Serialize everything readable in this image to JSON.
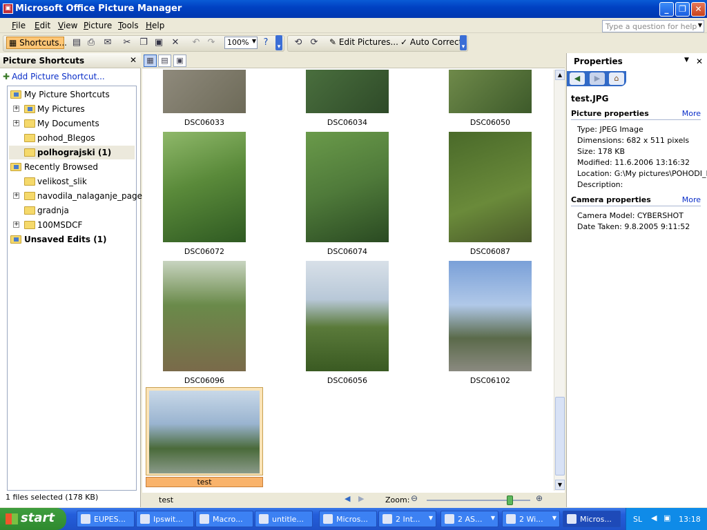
{
  "window": {
    "title": "Microsoft Office Picture Manager"
  },
  "menu": [
    "File",
    "Edit",
    "View",
    "Picture",
    "Tools",
    "Help"
  ],
  "help_box": {
    "placeholder": "Type a question for help"
  },
  "toolbar": {
    "shortcuts_label": "Shortcuts...",
    "zoom_value": "100%",
    "edit_pictures_label": "Edit Pictures...",
    "auto_correct_label": "Auto Correct"
  },
  "left_pane": {
    "title": "Picture Shortcuts",
    "add_shortcut": "Add Picture Shortcut...",
    "tree": [
      {
        "label": "My Picture Shortcuts",
        "bold": false
      },
      {
        "label": "My Pictures",
        "bold": false
      },
      {
        "label": "My Documents",
        "bold": false
      },
      {
        "label": "pohod_Blegos",
        "bold": false
      },
      {
        "label": "polhograjski (1)",
        "bold": true
      },
      {
        "label": "Recently Browsed",
        "bold": false
      },
      {
        "label": "velikost_slik",
        "bold": false
      },
      {
        "label": "navodila_nalaganje_page",
        "bold": false
      },
      {
        "label": "gradnja",
        "bold": false
      },
      {
        "label": "100MSDCF",
        "bold": false
      },
      {
        "label": "Unsaved Edits (1)",
        "bold": true
      }
    ],
    "status": "1 files selected (178 KB)"
  },
  "thumbnails": [
    {
      "name": "DSC06033",
      "colors": [
        "#8f8a7c",
        "#6d6a58"
      ]
    },
    {
      "name": "DSC06034",
      "colors": [
        "#4a6f3e",
        "#2e4a28"
      ]
    },
    {
      "name": "DSC06050",
      "colors": [
        "#6f8a4a",
        "#3d5a2a"
      ]
    },
    {
      "name": "DSC06072",
      "colors": [
        "#5a8a3a",
        "#2f5a22"
      ]
    },
    {
      "name": "DSC06074",
      "colors": [
        "#4f7a3a",
        "#2a4a22"
      ]
    },
    {
      "name": "DSC06087",
      "colors": [
        "#4a6a2a",
        "#6a8a3a"
      ]
    },
    {
      "name": "DSC06096",
      "colors": [
        "#6a8a4a",
        "#7a6a4a"
      ]
    },
    {
      "name": "DSC06056",
      "colors": [
        "#b8c8d8",
        "#5a7a3a"
      ]
    },
    {
      "name": "DSC06102",
      "colors": [
        "#7aa0d8",
        "#5a6a4a"
      ]
    },
    {
      "name": "test",
      "colors": [
        "#c8d8e8",
        "#4a6a3a"
      ]
    }
  ],
  "bottom_bar": {
    "current_name": "test",
    "zoom_label": "Zoom:"
  },
  "properties": {
    "title": "Properties",
    "file_name": "test.JPG",
    "picture_section": "Picture properties",
    "more_label": "More",
    "picture": [
      "Type: JPEG Image",
      "Dimensions: 682 x 511 pixels",
      "Size: 178 KB",
      "Modified: 11.6.2006 13:16:32",
      "Location:    G:\\My pictures\\POHODI_E",
      "Description:"
    ],
    "camera_section": "Camera properties",
    "camera": [
      "Camera Model: CYBERSHOT",
      "Date Taken: 9.8.2005 9:11:52"
    ]
  },
  "taskbar": {
    "start_label": "start",
    "tasks": [
      "EUPES...",
      "Ipswit...",
      "Macro...",
      "untitle...",
      "Micros...",
      "2 Int...",
      "2 AS...",
      "2 Wi...",
      "Micros..."
    ],
    "language": "SL",
    "clock": "13:18"
  }
}
